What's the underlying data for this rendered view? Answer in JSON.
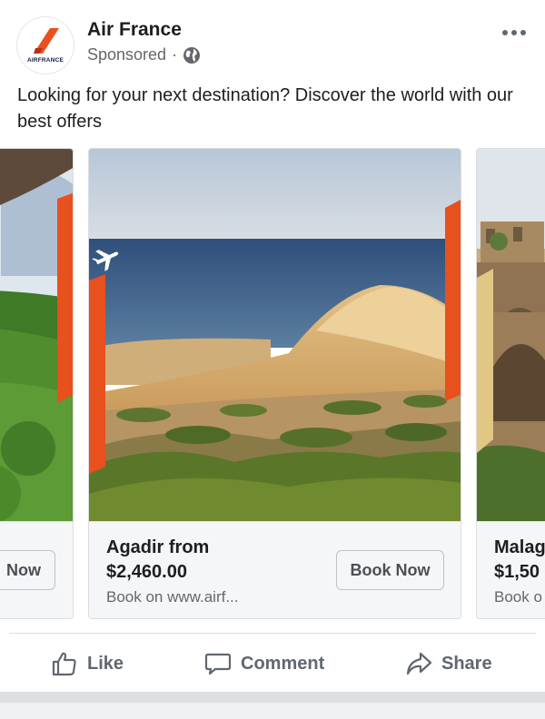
{
  "post": {
    "page_name": "Air France",
    "sponsored": "Sponsored",
    "separator": "·",
    "avatar_text": "AIRFRANCE",
    "caption": "Looking for your next destination? Discover the world with our best offers",
    "more_icon": "more-dots-icon",
    "privacy_icon": "globe-icon"
  },
  "carousel": {
    "cards": [
      {
        "title": "",
        "price": "",
        "link": "",
        "button": "Now"
      },
      {
        "title": "Agadir from",
        "price": "$2,460.00",
        "link": "Book on www.airf...",
        "button": "Book Now"
      },
      {
        "title": "Malag",
        "price": "$1,50",
        "link": "Book o",
        "button": ""
      }
    ]
  },
  "actions": {
    "like": "Like",
    "comment": "Comment",
    "share": "Share"
  },
  "colors": {
    "brand_orange": "#e8501e",
    "text_primary": "#1c1e21",
    "text_secondary": "#65676b",
    "sky": "#c9d6e3",
    "sea": "#40608a",
    "sand": "#d9b374",
    "brush": "#56702a"
  }
}
